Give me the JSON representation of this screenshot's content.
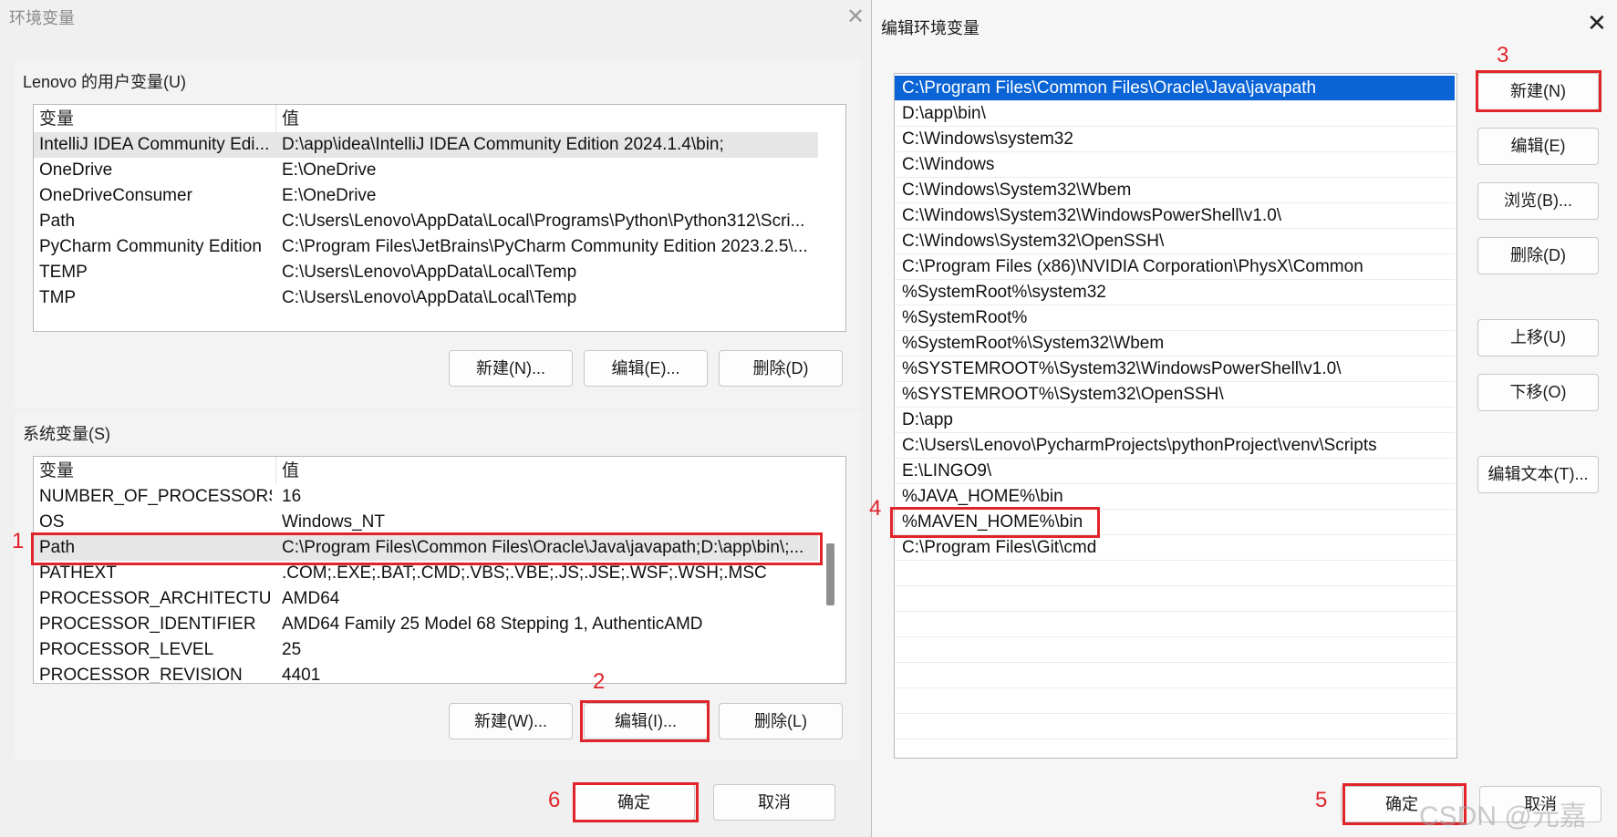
{
  "left_dialog": {
    "title": "环境变量",
    "user_group": {
      "label": "Lenovo 的用户变量(U)",
      "headers": [
        "变量",
        "值"
      ],
      "rows": [
        {
          "name": "IntelliJ IDEA Community Edi...",
          "value": "D:\\app\\idea\\IntelliJ IDEA Community Edition 2024.1.4\\bin;"
        },
        {
          "name": "OneDrive",
          "value": "E:\\OneDrive"
        },
        {
          "name": "OneDriveConsumer",
          "value": "E:\\OneDrive"
        },
        {
          "name": "Path",
          "value": "C:\\Users\\Lenovo\\AppData\\Local\\Programs\\Python\\Python312\\Scri..."
        },
        {
          "name": "PyCharm Community Edition",
          "value": "C:\\Program Files\\JetBrains\\PyCharm Community Edition 2023.2.5\\..."
        },
        {
          "name": "TEMP",
          "value": "C:\\Users\\Lenovo\\AppData\\Local\\Temp"
        },
        {
          "name": "TMP",
          "value": "C:\\Users\\Lenovo\\AppData\\Local\\Temp"
        }
      ],
      "buttons": {
        "new": "新建(N)...",
        "edit": "编辑(E)...",
        "delete": "删除(D)"
      }
    },
    "system_group": {
      "label": "系统变量(S)",
      "headers": [
        "变量",
        "值"
      ],
      "rows": [
        {
          "name": "NUMBER_OF_PROCESSORS",
          "value": "16"
        },
        {
          "name": "OS",
          "value": "Windows_NT"
        },
        {
          "name": "Path",
          "value": "C:\\Program Files\\Common Files\\Oracle\\Java\\javapath;D:\\app\\bin\\;..."
        },
        {
          "name": "PATHEXT",
          "value": ".COM;.EXE;.BAT;.CMD;.VBS;.VBE;.JS;.JSE;.WSF;.WSH;.MSC"
        },
        {
          "name": "PROCESSOR_ARCHITECTURE",
          "value": "AMD64"
        },
        {
          "name": "PROCESSOR_IDENTIFIER",
          "value": "AMD64 Family 25 Model 68 Stepping 1, AuthenticAMD"
        },
        {
          "name": "PROCESSOR_LEVEL",
          "value": "25"
        },
        {
          "name": "PROCESSOR_REVISION",
          "value": "4401"
        }
      ],
      "buttons": {
        "new": "新建(W)...",
        "edit": "编辑(I)...",
        "delete": "删除(L)"
      }
    },
    "ok": "确定",
    "cancel": "取消"
  },
  "right_dialog": {
    "title": "编辑环境变量",
    "paths": [
      "C:\\Program Files\\Common Files\\Oracle\\Java\\javapath",
      "D:\\app\\bin\\",
      "C:\\Windows\\system32",
      "C:\\Windows",
      "C:\\Windows\\System32\\Wbem",
      "C:\\Windows\\System32\\WindowsPowerShell\\v1.0\\",
      "C:\\Windows\\System32\\OpenSSH\\",
      "C:\\Program Files (x86)\\NVIDIA Corporation\\PhysX\\Common",
      "%SystemRoot%\\system32",
      "%SystemRoot%",
      "%SystemRoot%\\System32\\Wbem",
      "%SYSTEMROOT%\\System32\\WindowsPowerShell\\v1.0\\",
      "%SYSTEMROOT%\\System32\\OpenSSH\\",
      "D:\\app",
      "C:\\Users\\Lenovo\\PycharmProjects\\pythonProject\\venv\\Scripts",
      "E:\\LINGO9\\",
      "%JAVA_HOME%\\bin",
      "%MAVEN_HOME%\\bin",
      "C:\\Program Files\\Git\\cmd"
    ],
    "selected_index": 0,
    "buttons": {
      "new": "新建(N)",
      "edit": "编辑(E)",
      "browse": "浏览(B)...",
      "delete": "删除(D)",
      "move_up": "上移(U)",
      "move_down": "下移(O)",
      "edit_text": "编辑文本(T)..."
    },
    "ok": "确定",
    "cancel": "取消"
  },
  "annotations": [
    "1",
    "2",
    "3",
    "4",
    "5",
    "6"
  ],
  "watermark": "CSDN @元嘉",
  "colors": {
    "annotation": "#e0242a",
    "selection": "#0a64d6"
  }
}
